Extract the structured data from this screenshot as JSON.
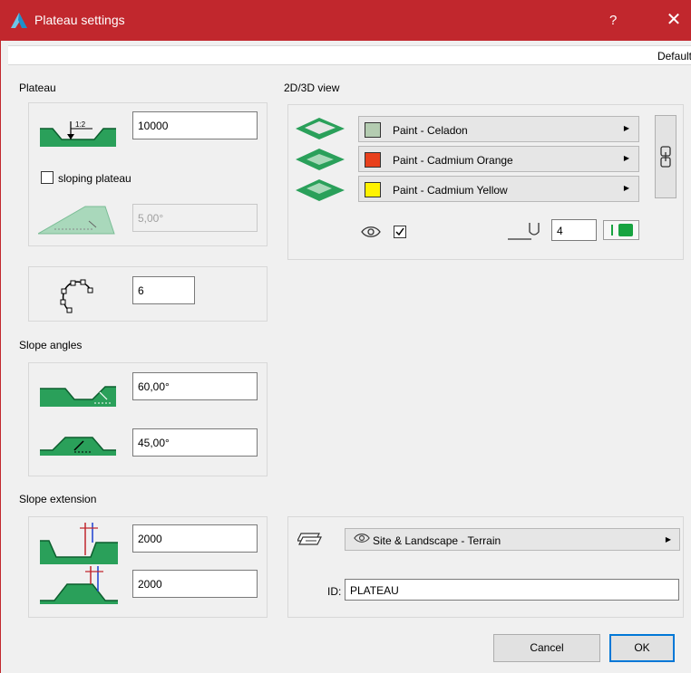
{
  "window": {
    "title": "Plateau settings",
    "help_label": "?",
    "close_label": "✕",
    "accent_color": "#c1272d"
  },
  "favorites": {
    "label": "Default"
  },
  "plateau": {
    "title": "Plateau",
    "height_icon_label": "1:2",
    "height_value": "10000",
    "sloping_label": "sloping plateau",
    "sloping_checked": false,
    "angle_value": "5,00°",
    "points_value": "6"
  },
  "view": {
    "title": "2D/3D view",
    "paints": [
      {
        "label": "Paint - Celadon",
        "color": "#b4ccb1"
      },
      {
        "label": "Paint - Cadmium Orange",
        "color": "#e8401c"
      },
      {
        "label": "Paint - Cadmium Yellow",
        "color": "#fff200"
      }
    ],
    "visible_checked": true,
    "pen_value": "4",
    "pen_color": "#17a340"
  },
  "slope_angles": {
    "title": "Slope angles",
    "cut_value": "60,00°",
    "fill_value": "45,00°"
  },
  "slope_extension": {
    "title": "Slope extension",
    "cut_value": "2000",
    "fill_value": "2000"
  },
  "layer": {
    "value": "Site & Landscape - Terrain",
    "id_label": "ID:",
    "id_value": "PLATEAU"
  },
  "buttons": {
    "cancel": "Cancel",
    "ok": "OK"
  }
}
